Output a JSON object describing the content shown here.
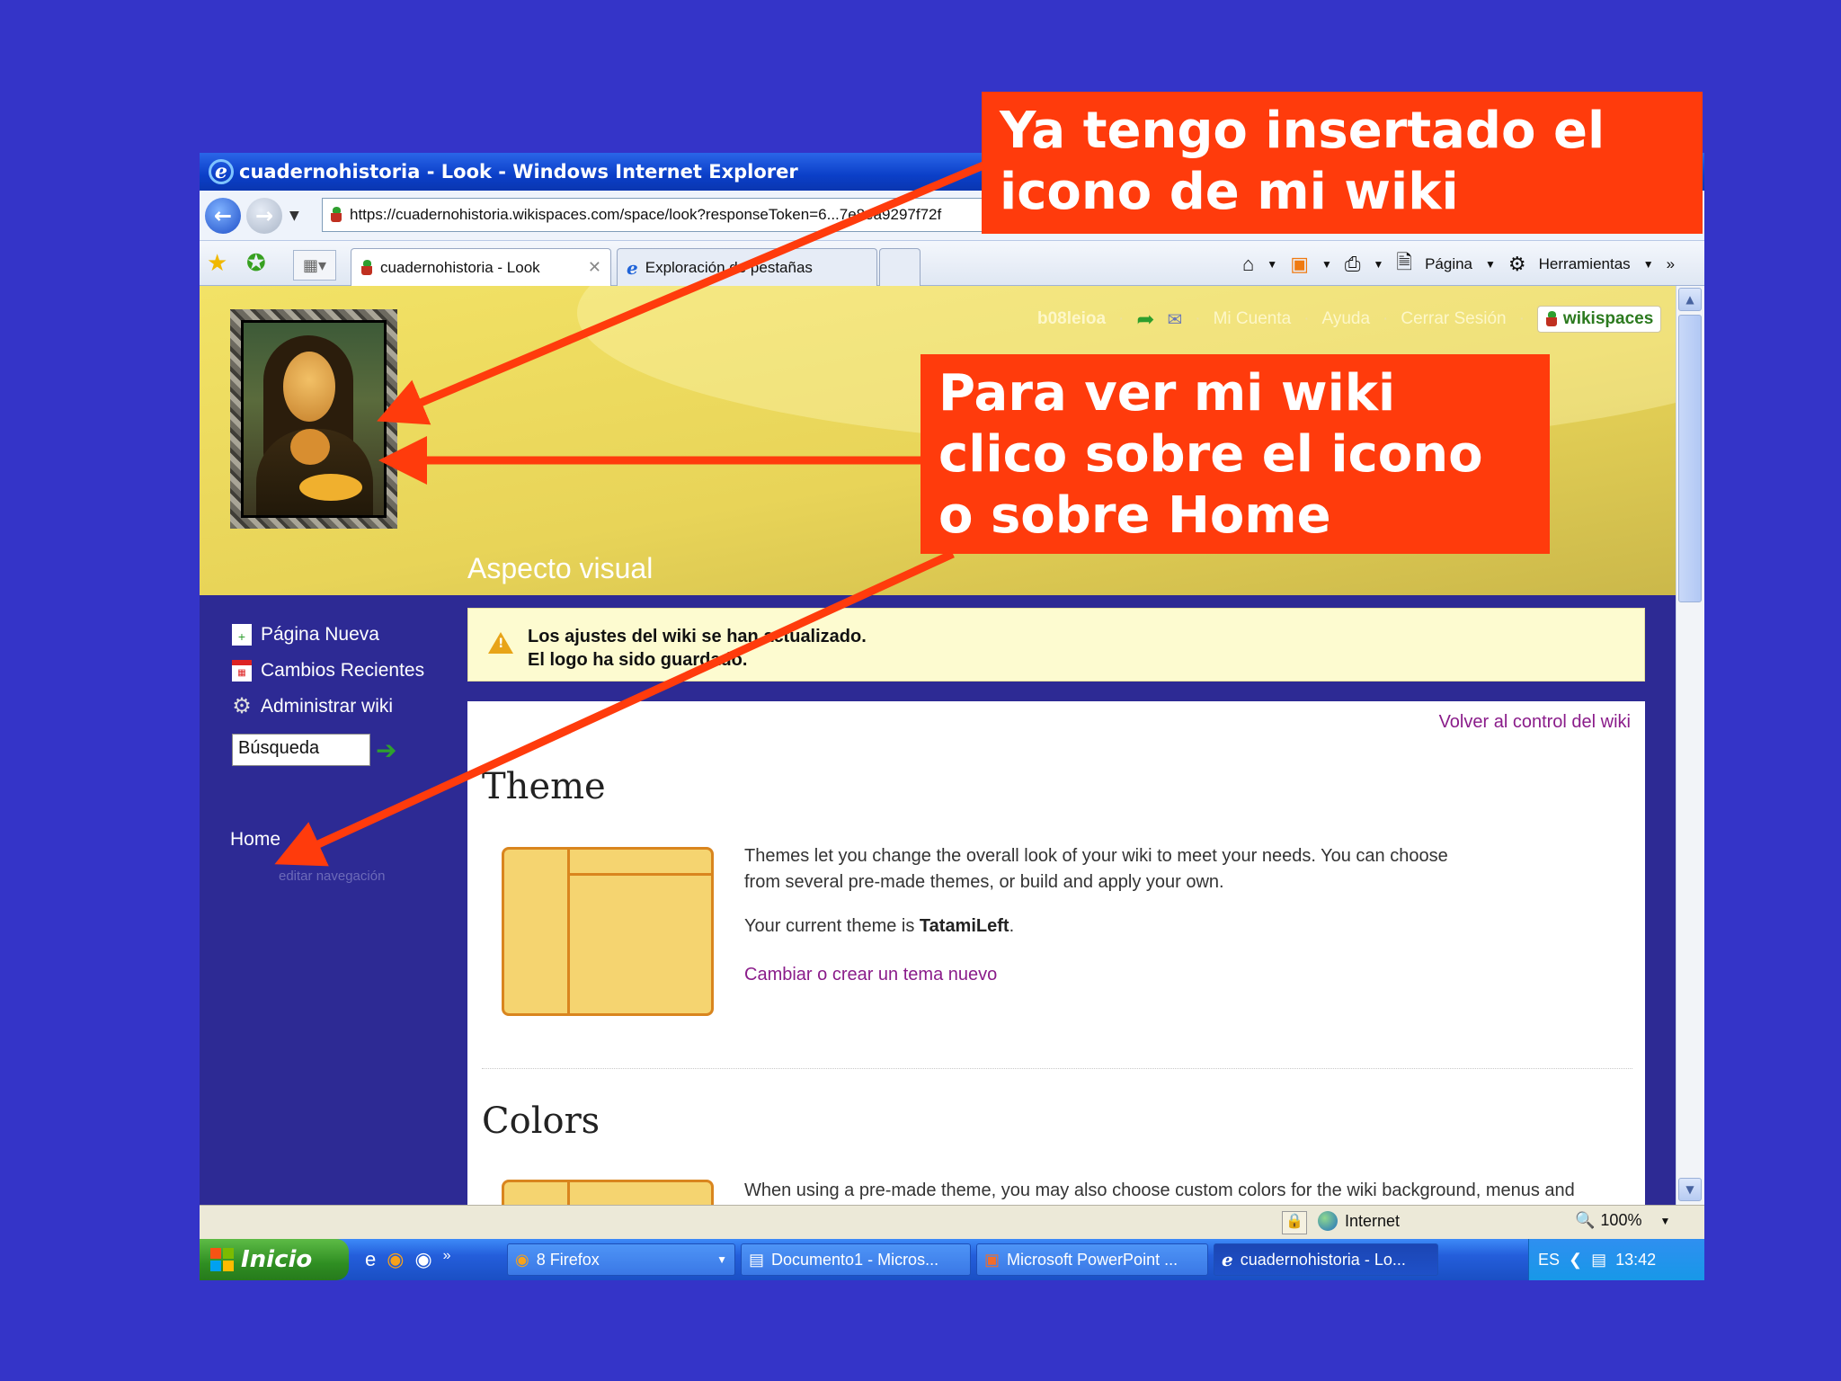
{
  "window": {
    "title": "cuadernohistoria - Look - Windows Internet Explorer",
    "address": "https://cuadernohistoria.wikispaces.com/space/look?responseToken=6...7e8ea9297f72f",
    "tabs": [
      {
        "label": "cuadernohistoria - Look",
        "active": true
      },
      {
        "label": "Exploración de pestañas",
        "active": false
      }
    ],
    "toolbar": {
      "page": "Página",
      "tools": "Herramientas",
      "more": "»"
    }
  },
  "wiki": {
    "user": "b08leioa",
    "links": [
      "Mi Cuenta",
      "Ayuda",
      "Cerrar Sesión"
    ],
    "badge": "wikispaces",
    "page_heading": "Aspecto visual",
    "sidebar": {
      "items": [
        "Página Nueva",
        "Cambios Recientes",
        "Administrar wiki"
      ],
      "search_value": "Búsqueda",
      "home": "Home",
      "edit_nav": "editar navegación"
    },
    "notice": {
      "line1": "Los ajustes del wiki se han actualizado.",
      "line2": "El logo ha sido guardado."
    },
    "back_link": "Volver al control del wiki",
    "theme": {
      "title": "Theme",
      "desc1": "Themes let you change the overall look of your wiki to meet your needs. You can choose",
      "desc2": "from several pre-made themes, or build and apply your own.",
      "current_prefix": "Your current theme is ",
      "current_name": "TatamiLeft",
      "current_suffix": ".",
      "change_link": "Cambiar o crear un tema nuevo"
    },
    "colors": {
      "title": "Colors",
      "desc": "When using a pre-made theme, you may also choose custom colors for the wiki background, menus and"
    }
  },
  "statusbar": {
    "zone": "Internet",
    "zoom": "100%"
  },
  "taskbar": {
    "start": "Inicio",
    "tasks": [
      "8 Firefox",
      "Documento1 - Micros...",
      "Microsoft PowerPoint ...",
      "cuadernohistoria - Lo..."
    ],
    "lang": "ES",
    "time": "13:42"
  },
  "callouts": {
    "c1_line1": "Ya tengo insertado el",
    "c1_line2": "icono de mi wiki",
    "c2_line1": "Para ver mi wiki",
    "c2_line2": "clico sobre el icono",
    "c2_line3": "o sobre Home"
  },
  "colors": {
    "background": "#3434c8",
    "callout": "#ff3b0c",
    "banner": "#e8d458",
    "sidebar": "#2d2a94",
    "link": "#8a1c8a"
  }
}
